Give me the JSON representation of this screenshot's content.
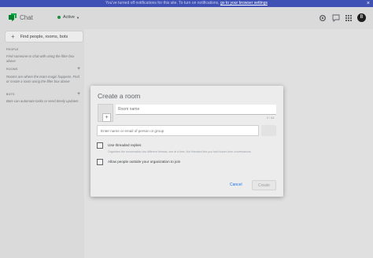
{
  "notification": {
    "text": "You've turned off notifications for this site. To turn on notifications,",
    "link": "go to your browser settings",
    "close": "×"
  },
  "header": {
    "app_title": "Chat",
    "status": "Active",
    "avatar_letter": "B",
    "logo_color": "#00832d"
  },
  "sidebar": {
    "find_button": "Find people, rooms, bots",
    "sections": [
      {
        "title": "PEOPLE",
        "text": "Find someone to chat with using the filter box above"
      },
      {
        "title": "ROOMS",
        "text": "Rooms are where the team magic happens. Find or create a room using the filter box above"
      },
      {
        "title": "BOTS",
        "text": "Bots can automate tasks or send timely updates"
      }
    ]
  },
  "dialog": {
    "title": "Create a room",
    "room_name_placeholder": "Room name",
    "counter": "0 / 64",
    "people_placeholder": "Enter name or email of person or group",
    "threaded_label": "Use threaded replies",
    "threaded_desc": "Organizes the conversation into different threads, one at a time. Not threaded lets you hold looser-form conversations.",
    "outside_label": "Allow people outside your organization to join",
    "cancel": "Cancel",
    "create": "Create"
  }
}
